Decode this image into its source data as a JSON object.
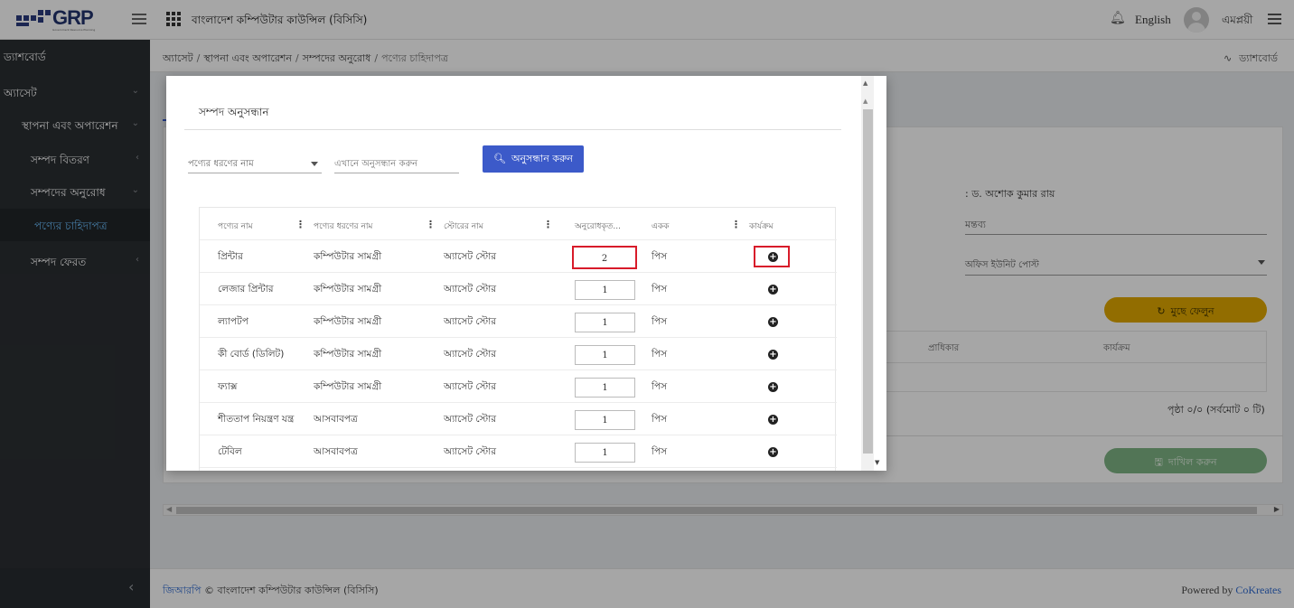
{
  "header": {
    "org_title": "বাংলাদেশ কম্পিউটার কাউন্সিল (বিসিসি)",
    "language": "English",
    "username": "এমপ্লয়ী"
  },
  "logo": {
    "text": "GRP",
    "tagline": "Government Resource Planning"
  },
  "sidebar": {
    "items": [
      {
        "label": "ড্যাশবোর্ড",
        "icon": "dashboard-icon"
      },
      {
        "label": "অ্যাসেট",
        "icon": "asset-icon"
      },
      {
        "label": "স্থাপনা এবং অপারেশন"
      },
      {
        "label": "সম্পদ বিতরণ"
      },
      {
        "label": "সম্পদের অনুরোধ"
      },
      {
        "label": "পণ্যের চাহিদাপত্র",
        "active": true
      },
      {
        "label": "সম্পদ ফেরত"
      }
    ]
  },
  "breadcrumb": {
    "items": [
      "অ্যাসেট",
      "স্থাপনা এবং অপারেশন",
      "সম্পদের অনুরোধ",
      "পণ্যের চাহিদাপত্র"
    ],
    "dashboard_link": "ড্যাশবোর্ড"
  },
  "background_page": {
    "officer": ": ড. অশোক কুমার রায়",
    "remark_label": "মন্তব্য",
    "office_unit_post": "অফিস ইউনিট পোস্ট",
    "clear_button": "মুছে ফেলুন",
    "table_headers": [
      "প্রাধিকার",
      "কার্যক্রম"
    ],
    "pager": "পৃষ্ঠা ০/০ (সর্বমোট ০ টি)",
    "submit_button": "দাখিল করুন"
  },
  "modal": {
    "title": "সম্পদ অনুসন্ধান",
    "type_select_label": "পণ্যের ধরণের নাম",
    "search_placeholder": "এখানে অনুসন্ধান করুন",
    "search_button": "অনুসন্ধান করুন",
    "columns": [
      "পণ্যের নাম",
      "পণ্যের ধরণের নাম",
      "স্টোরের নাম",
      "অনুরোধকৃত...",
      "একক",
      "কার্যক্রম"
    ],
    "rows": [
      {
        "name": "প্রিন্টার",
        "type": "কম্পিউটার সামগ্রী",
        "store": "অ্যাসেট স্টোর",
        "qty": "2",
        "unit": "পিস"
      },
      {
        "name": "লেজার প্রিন্টার",
        "type": "কম্পিউটার সামগ্রী",
        "store": "অ্যাসেট স্টোর",
        "qty": "1",
        "unit": "পিস"
      },
      {
        "name": "ল্যাপটপ",
        "type": "কম্পিউটার সামগ্রী",
        "store": "অ্যাসেট স্টোর",
        "qty": "1",
        "unit": "পিস"
      },
      {
        "name": "কী বোর্ড (ডিলিট)",
        "type": "কম্পিউটার সামগ্রী",
        "store": "অ্যাসেট স্টোর",
        "qty": "1",
        "unit": "পিস"
      },
      {
        "name": "ফ্যাক্স",
        "type": "কম্পিউটার সামগ্রী",
        "store": "অ্যাসেট স্টোর",
        "qty": "1",
        "unit": "পিস"
      },
      {
        "name": "শীততাপ নিয়ন্ত্রণ যন্ত্র",
        "type": "আসবাবপত্র",
        "store": "অ্যাসেট স্টোর",
        "qty": "1",
        "unit": "পিস"
      },
      {
        "name": "টেবিল",
        "type": "আসবাবপত্র",
        "store": "অ্যাসেট স্টোর",
        "qty": "1",
        "unit": "পিস"
      }
    ]
  },
  "footer": {
    "brand_link": "জিআরপি",
    "copyright": " © বাংলাদেশ কম্পিউটার কাউন্সিল (বিসিসি)",
    "powered_by": "Powered by ",
    "powered_link": "CoKreates"
  },
  "colors": {
    "accent": "#3c5ac9",
    "sidebar_bg": "#2a2e32",
    "highlight": "#d81b2a",
    "warning": "#e0a800",
    "success": "#7fb485"
  }
}
